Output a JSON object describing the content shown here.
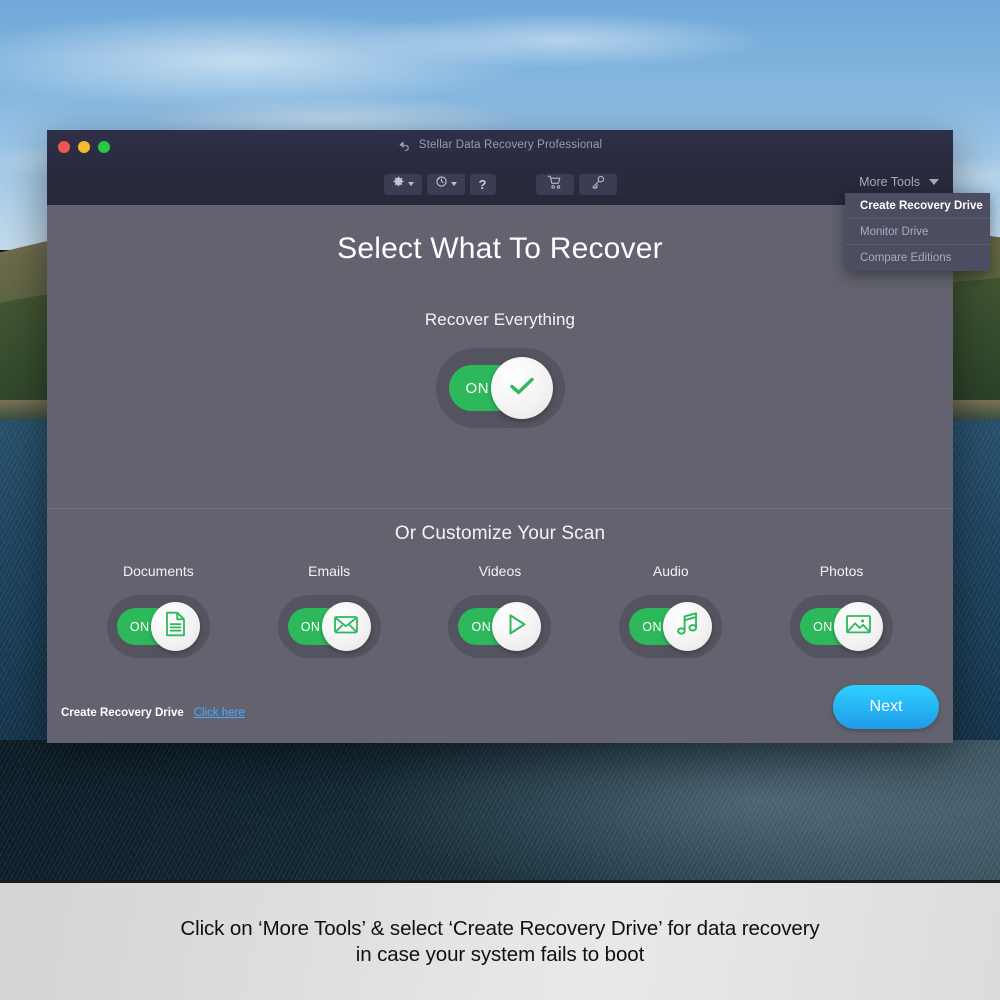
{
  "window": {
    "title": "Stellar Data Recovery Professional",
    "traffic_lights": [
      {
        "name": "close",
        "color": "#f2554f"
      },
      {
        "name": "minimize",
        "color": "#f6bb2f"
      },
      {
        "name": "maximize",
        "color": "#28c940"
      }
    ]
  },
  "toolbar": {
    "items": [
      {
        "icon": "gear-icon",
        "has_caret": true
      },
      {
        "icon": "history-clock-icon",
        "has_caret": true
      },
      {
        "icon": "help-question-icon",
        "label": "?",
        "has_caret": false
      },
      {
        "icon": "shopping-cart-icon",
        "has_caret": false
      },
      {
        "icon": "key-icon",
        "has_caret": false
      }
    ],
    "more_tools_label": "More Tools"
  },
  "dropdown": {
    "items": [
      {
        "label": "Create Recovery Drive",
        "active": true
      },
      {
        "label": "Monitor Drive",
        "active": false
      },
      {
        "label": "Compare Editions",
        "active": false
      }
    ]
  },
  "main": {
    "heading": "Select What To Recover",
    "subheading": "Recover Everything",
    "master_toggle": {
      "state_label": "ON",
      "icon": "check-icon",
      "on": true
    },
    "customize_heading": "Or Customize Your Scan",
    "categories": [
      {
        "label": "Documents",
        "icon": "document-icon",
        "state_label": "ON",
        "on": true
      },
      {
        "label": "Emails",
        "icon": "envelope-icon",
        "state_label": "ON",
        "on": true
      },
      {
        "label": "Videos",
        "icon": "play-icon",
        "state_label": "ON",
        "on": true
      },
      {
        "label": "Audio",
        "icon": "music-note-icon",
        "state_label": "ON",
        "on": true
      },
      {
        "label": "Photos",
        "icon": "image-icon",
        "state_label": "ON",
        "on": true
      }
    ]
  },
  "footer": {
    "recovery_label": "Create Recovery Drive",
    "recovery_link": "Click here",
    "next_label": "Next"
  },
  "caption": {
    "line1": "Click on ‘More Tools’ & select ‘Create Recovery Drive’ for data recovery",
    "line2": "in case your system fails to boot"
  },
  "colors": {
    "accent_green": "#2eb85c",
    "next_blue": "#27b6f5",
    "link_blue": "#4aa8ff",
    "titlebar": "#2a2b40",
    "body_bg": "#62636f",
    "toggle_track_off": "#53545f",
    "dropdown_bg": "#4c4d60"
  }
}
